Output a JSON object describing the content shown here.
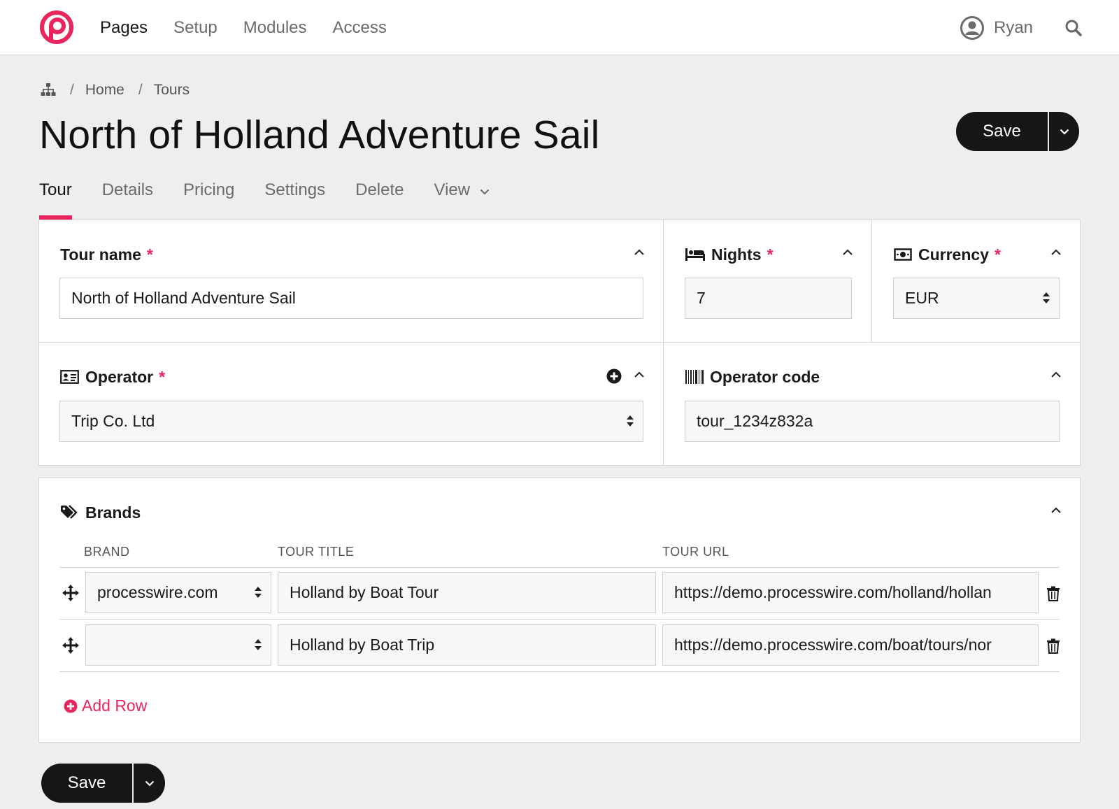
{
  "nav": {
    "items": [
      {
        "label": "Pages"
      },
      {
        "label": "Setup"
      },
      {
        "label": "Modules"
      },
      {
        "label": "Access"
      }
    ],
    "user": "Ryan",
    "accent": "#e8265d"
  },
  "breadcrumb": {
    "items": [
      "Home",
      "Tours"
    ],
    "separator": "/"
  },
  "page": {
    "title": "North of Holland Adventure Sail",
    "save_label": "Save"
  },
  "tabs": [
    {
      "label": "Tour"
    },
    {
      "label": "Details"
    },
    {
      "label": "Pricing"
    },
    {
      "label": "Settings"
    },
    {
      "label": "Delete"
    },
    {
      "label": "View"
    }
  ],
  "fields": {
    "tour_name": {
      "label": "Tour name",
      "value": "North of Holland Adventure Sail",
      "required": "*"
    },
    "nights": {
      "label": "Nights",
      "value": "7",
      "required": "*"
    },
    "currency": {
      "label": "Currency",
      "value": "EUR",
      "required": "*"
    },
    "operator": {
      "label": "Operator",
      "value": "Trip Co. Ltd",
      "required": "*"
    },
    "operator_code": {
      "label": "Operator code",
      "value": "tour_1234z832a"
    }
  },
  "brands": {
    "label": "Brands",
    "columns": [
      "BRAND",
      "TOUR TITLE",
      "TOUR URL"
    ],
    "rows": [
      {
        "brand": "processwire.com",
        "title": "Holland by Boat Tour",
        "url": "https://demo.processwire.com/holland/hollan"
      },
      {
        "brand": "",
        "title": "Holland by Boat Trip",
        "url": "https://demo.processwire.com/boat/tours/nor"
      }
    ],
    "add_row_label": "Add Row"
  },
  "icons": {
    "logo": "processwire-logo",
    "user": "user-circle-icon",
    "search": "search-icon",
    "sitemap": "sitemap-icon",
    "bed": "bed-icon",
    "money": "money-icon",
    "id_card": "id-card-icon",
    "barcode": "barcode-icon",
    "tags": "tags-icon",
    "move": "arrows-move-icon",
    "trash": "trash-icon",
    "plus_circle": "plus-circle-icon",
    "chevron_up": "chevron-up-icon",
    "chevron_down": "chevron-down-icon"
  }
}
